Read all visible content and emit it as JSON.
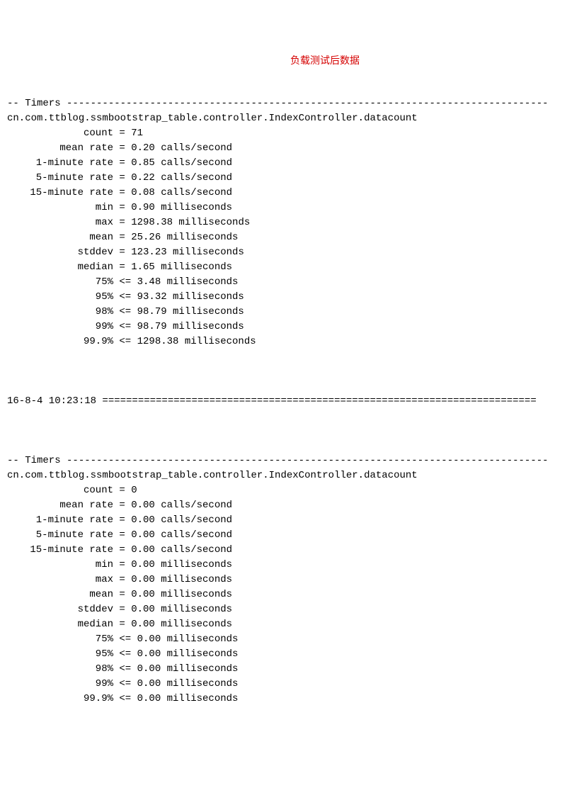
{
  "section1": {
    "header_prefix": "-- Timers ",
    "header_dashes": "---------------------------------------------------------------------------------",
    "class_name": "cn.com.ttblog.ssmbootstrap_table.controller.IndexController.datacount",
    "annotation": "负载测试后数据",
    "rows": [
      {
        "label": "         count",
        "op": " = ",
        "value": "71"
      },
      {
        "label": "     mean rate",
        "op": " = ",
        "value": "0.20 calls/second"
      },
      {
        "label": " 1-minute rate",
        "op": " = ",
        "value": "0.85 calls/second"
      },
      {
        "label": " 5-minute rate",
        "op": " = ",
        "value": "0.22 calls/second"
      },
      {
        "label": "15-minute rate",
        "op": " = ",
        "value": "0.08 calls/second"
      },
      {
        "label": "           min",
        "op": " = ",
        "value": "0.90 milliseconds"
      },
      {
        "label": "           max",
        "op": " = ",
        "value": "1298.38 milliseconds"
      },
      {
        "label": "          mean",
        "op": " = ",
        "value": "25.26 milliseconds"
      },
      {
        "label": "        stddev",
        "op": " = ",
        "value": "123.23 milliseconds"
      },
      {
        "label": "        median",
        "op": " = ",
        "value": "1.65 milliseconds"
      },
      {
        "label": "           75%",
        "op": " <= ",
        "value": "3.48 milliseconds"
      },
      {
        "label": "           95%",
        "op": " <= ",
        "value": "93.32 milliseconds"
      },
      {
        "label": "           98%",
        "op": " <= ",
        "value": "98.79 milliseconds"
      },
      {
        "label": "           99%",
        "op": " <= ",
        "value": "98.79 milliseconds"
      },
      {
        "label": "         99.9%",
        "op": " <= ",
        "value": "1298.38 milliseconds"
      }
    ]
  },
  "timestamp_line": {
    "timestamp": "16-8-4 10:23:18 ",
    "equals": "========================================================================="
  },
  "section2": {
    "header_prefix": "-- Timers ",
    "header_dashes": "---------------------------------------------------------------------------------",
    "class_name": "cn.com.ttblog.ssmbootstrap_table.controller.IndexController.datacount",
    "rows": [
      {
        "label": "         count",
        "op": " = ",
        "value": "0"
      },
      {
        "label": "     mean rate",
        "op": " = ",
        "value": "0.00 calls/second"
      },
      {
        "label": " 1-minute rate",
        "op": " = ",
        "value": "0.00 calls/second"
      },
      {
        "label": " 5-minute rate",
        "op": " = ",
        "value": "0.00 calls/second"
      },
      {
        "label": "15-minute rate",
        "op": " = ",
        "value": "0.00 calls/second"
      },
      {
        "label": "           min",
        "op": " = ",
        "value": "0.00 milliseconds"
      },
      {
        "label": "           max",
        "op": " = ",
        "value": "0.00 milliseconds"
      },
      {
        "label": "          mean",
        "op": " = ",
        "value": "0.00 milliseconds"
      },
      {
        "label": "        stddev",
        "op": " = ",
        "value": "0.00 milliseconds"
      },
      {
        "label": "        median",
        "op": " = ",
        "value": "0.00 milliseconds"
      },
      {
        "label": "           75%",
        "op": " <= ",
        "value": "0.00 milliseconds"
      },
      {
        "label": "           95%",
        "op": " <= ",
        "value": "0.00 milliseconds"
      },
      {
        "label": "           98%",
        "op": " <= ",
        "value": "0.00 milliseconds"
      },
      {
        "label": "           99%",
        "op": " <= ",
        "value": "0.00 milliseconds"
      },
      {
        "label": "         99.9%",
        "op": " <= ",
        "value": "0.00 milliseconds"
      }
    ]
  }
}
